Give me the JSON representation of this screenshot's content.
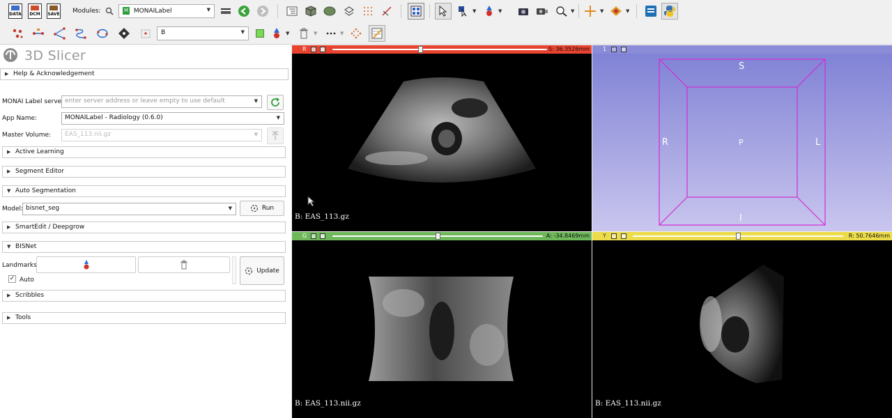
{
  "toolbar": {
    "data_label": "DATA",
    "dcm_label": "DCM",
    "save_label": "SAVE",
    "modules_label": "Modules:",
    "module_selected": "MONAILabel",
    "segment_selected": "B"
  },
  "panel": {
    "app_title": "3D Slicer",
    "help_section": "Help & Acknowledgement",
    "server_label": "MONAI Label server:",
    "server_placeholder": "enter server address or leave empty to use default",
    "appname_label": "App Name:",
    "appname_value": "MONAILabel - Radiology (0.6.0)",
    "master_label": "Master Volume:",
    "master_value": "EAS_113.nii.gz",
    "sections": {
      "active_learning": "Active Learning",
      "segment_editor": "Segment Editor",
      "auto_segmentation": "Auto Segmentation",
      "smartedit": "SmartEdit / Deepgrow",
      "bisnet": "BISNet",
      "scribbles": "Scribbles",
      "tools": "Tools"
    },
    "model_label": "Model:",
    "model_value": "bisnet_seg",
    "run_label": "Run",
    "landmarks_label": "Landmarks:",
    "update_label": "Update",
    "auto_label": "Auto",
    "auto_checked": "✓"
  },
  "views": {
    "red": {
      "letter": "R",
      "offset": "S: 36.3526mm",
      "caption": "B: EAS_113.gz",
      "color": "#e8432f",
      "slider_fraction": 0.41
    },
    "threeD": {
      "letter": "1",
      "labels": {
        "S": "S",
        "I": "I",
        "R": "R",
        "L": "L",
        "P": "P"
      },
      "color": "#8a8cd8"
    },
    "green": {
      "letter": "G",
      "offset": "A: -34.8469mm",
      "caption": "B: EAS_113.nii.gz",
      "color": "#6eb85a",
      "slider_fraction": 0.5
    },
    "yellow": {
      "letter": "Y",
      "offset": "R: 50.7646mm",
      "caption": "B: EAS_113.nii.gz",
      "color": "#eddc4a",
      "slider_fraction": 0.5
    }
  },
  "colors": {
    "accent_green": "#2e9e3a",
    "bg_3d_top": "#7d7fd4",
    "bg_3d_bottom": "#c9c6ee",
    "box_magenta": "#d42ad4"
  }
}
